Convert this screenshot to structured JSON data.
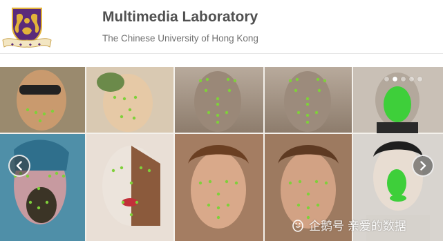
{
  "header": {
    "title": "Multimedia Laboratory",
    "subtitle": "The Chinese University of Hong Kong",
    "logo_icon": "cuhk-crest-logo"
  },
  "carousel": {
    "slide_count": 5,
    "active_index": 1,
    "prev_icon": "chevron-left-icon",
    "next_icon": "chevron-right-icon",
    "landmark_color": "#7fd03a",
    "mask_color": "#3ecf3a"
  },
  "watermark": {
    "icon": "penguin-icon",
    "text": "企鹅号 亲爱的数据"
  },
  "colors": {
    "crest_purple": "#5a2a7a",
    "crest_gold": "#e2b33a",
    "title": "#505050",
    "subtitle": "#707070"
  }
}
